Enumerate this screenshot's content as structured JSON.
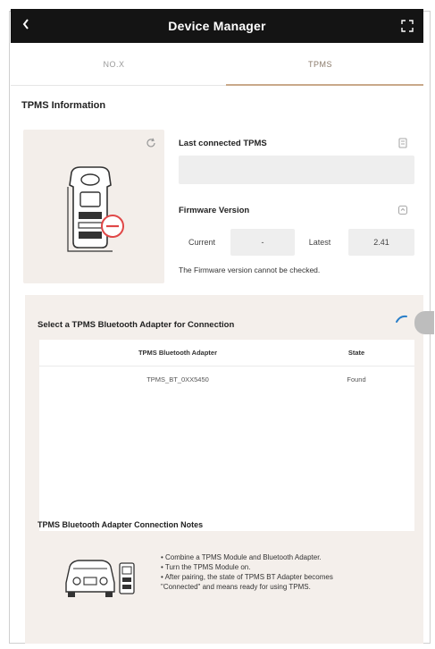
{
  "header": {
    "title": "Device Manager",
    "back_icon": "chevron-left-icon",
    "expand_icon": "expand-icon"
  },
  "tabs": [
    {
      "label": "NO.X",
      "active": false
    },
    {
      "label": "TPMS",
      "active": true
    }
  ],
  "tpms_info": {
    "section_title": "TPMS Information",
    "last_connected_label": "Last connected TPMS",
    "last_connected_value": "",
    "firmware_label": "Firmware Version",
    "current_label": "Current",
    "current_value": "-",
    "latest_label": "Latest",
    "latest_value": "2.41",
    "firmware_note": "The Firmware version cannot be checked."
  },
  "adapter": {
    "section_title": "Select a TPMS Bluetooth Adapter for Connection",
    "columns": [
      "TPMS Bluetooth Adapter",
      "State"
    ],
    "rows": [
      {
        "name": "TPMS_BT_0XX5450",
        "state": "Found"
      }
    ]
  },
  "notes": {
    "title": "TPMS Bluetooth Adapter Connection Notes",
    "items": [
      "• Combine a TPMS Module and Bluetooth Adapter.",
      "• Turn the TPMS Module on.",
      "• After pairing, the state of TPMS BT Adapter becomes",
      "\"Connected\" and means ready for using TPMS."
    ]
  },
  "colors": {
    "header_bg": "#141414",
    "accent": "#c9a98a",
    "panel_bg": "#f3eeea",
    "field_bg": "#eeeeee",
    "spinner": "#2a7fc9"
  }
}
